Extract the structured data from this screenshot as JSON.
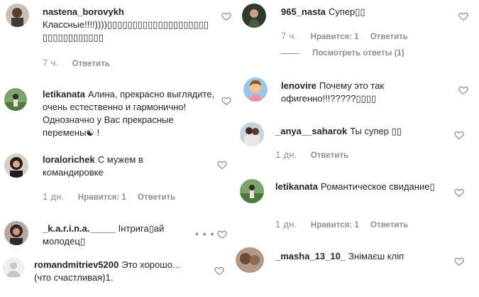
{
  "left_comments": [
    {
      "username": "nastena_borovykh",
      "text": "Классные!!!!))))▯▯▯▯▯▯▯▯▯▯▯▯▯▯▯▯▯▯▯▯▯▯▯▯▯▯▯▯▯▯▯▯",
      "time": "7 ч.",
      "reply": "Ответить",
      "likes": ""
    },
    {
      "username": "letikanata",
      "text": "Алина, прекрасно выглядите, очень естественно и гармонично! Однозначно у Вас прекрасные перемены☯ !",
      "time": "",
      "reply": "",
      "likes": ""
    },
    {
      "username": "loralorichek",
      "text": "С мужем в командировке",
      "time": "1 дн.",
      "likes": "Нравится: 1",
      "reply": "Ответить"
    },
    {
      "username": "_k.a.r.i.n.a._____",
      "text": "Інтрига▯ай молодец▯",
      "time": "",
      "reply": "",
      "likes": ""
    },
    {
      "username": "romandmitriev5200",
      "text": "Это хорошо... (что счастливая)1.",
      "time": "",
      "reply": "",
      "likes": ""
    }
  ],
  "right_comments": [
    {
      "username": "965_nasta",
      "text": "Супер▯▯",
      "time": "7 ч.",
      "likes": "Нравится: 1",
      "reply": "Ответить",
      "view_replies": "Посмотреть ответы (1)"
    },
    {
      "username": "lenovire",
      "text": "Почему это так офигенно!!!?????▯▯▯▯",
      "time": "",
      "likes": "",
      "reply": ""
    },
    {
      "username": "_anya__saharok",
      "text": "Ты супер ▯▯",
      "time": "1 дн.",
      "likes": "",
      "reply": "Ответить"
    },
    {
      "username": "letikanata",
      "text": "Романтическое свидание▯",
      "time": "1 дн.",
      "likes": "Нравится: 1",
      "reply": "Ответить"
    },
    {
      "username": "_masha_13_10_",
      "text": "Знімаєш кліп",
      "time": "",
      "likes": "",
      "reply": ""
    }
  ],
  "more_options": "• • •",
  "colors": {
    "text": "#262626",
    "muted": "#8e8e8e",
    "background": "#ffffff"
  },
  "icons": {
    "heart": "heart-outline-icon",
    "more": "more-options-icon"
  }
}
